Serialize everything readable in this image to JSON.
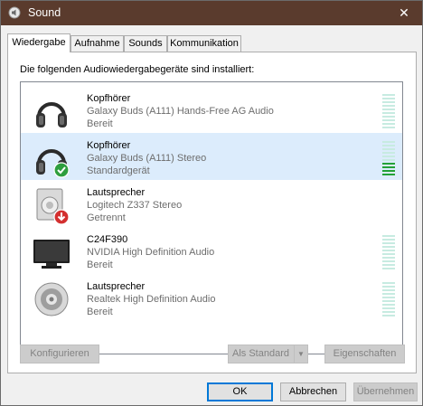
{
  "window": {
    "title": "Sound",
    "close_glyph": "✕"
  },
  "tabs": [
    {
      "label": "Wiedergabe",
      "active": true
    },
    {
      "label": "Aufnahme",
      "active": false
    },
    {
      "label": "Sounds",
      "active": false
    },
    {
      "label": "Kommunikation",
      "active": false
    }
  ],
  "panel": {
    "intro": "Die folgenden Audiowiedergabegeräte sind installiert:"
  },
  "devices": [
    {
      "name": "Kopfhörer",
      "description": "Galaxy Buds (A111) Hands-Free AG Audio",
      "status": "Bereit",
      "icon": "headphones-icon",
      "badge": "",
      "selected": false,
      "level": 0
    },
    {
      "name": "Kopfhörer",
      "description": "Galaxy Buds (A111) Stereo",
      "status": "Standardgerät",
      "icon": "headphones-icon",
      "badge": "default-check-icon",
      "selected": true,
      "level": 0.35
    },
    {
      "name": "Lautsprecher",
      "description": "Logitech Z337 Stereo",
      "status": "Getrennt",
      "icon": "speaker-box-icon",
      "badge": "disconnected-arrow-icon",
      "selected": false,
      "level": null
    },
    {
      "name": "C24F390",
      "description": "NVIDIA High Definition Audio",
      "status": "Bereit",
      "icon": "monitor-icon",
      "badge": "",
      "selected": false,
      "level": 0
    },
    {
      "name": "Lautsprecher",
      "description": "Realtek High Definition Audio",
      "status": "Bereit",
      "icon": "speaker-icon",
      "badge": "",
      "selected": false,
      "level": 0
    }
  ],
  "panel_buttons": {
    "configure": "Konfigurieren",
    "set_default": "Als Standard",
    "properties": "Eigenschaften"
  },
  "dialog_buttons": {
    "ok": "OK",
    "cancel": "Abbrechen",
    "apply": "Übernehmen"
  },
  "colors": {
    "titlebar": "#5a3b2d",
    "selection": "#dcecfc",
    "meter_off": "#c7ebe1",
    "meter_on": "#23a136",
    "default_badge": "#2e9e3e",
    "disconnected_badge": "#d32f2f"
  }
}
